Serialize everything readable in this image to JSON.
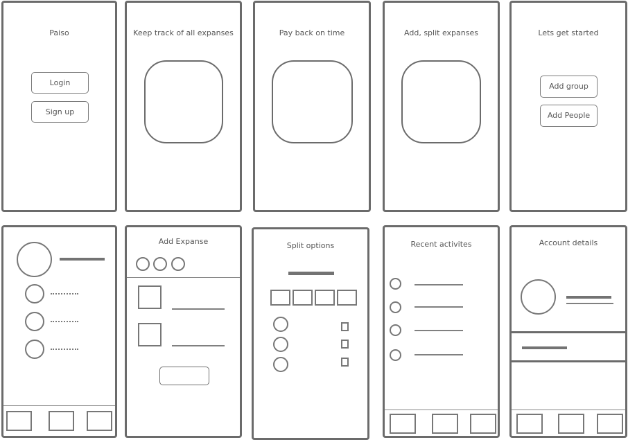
{
  "screens": {
    "splash": {
      "title": "Paiso",
      "login_label": "Login",
      "signup_label": "Sign up"
    },
    "onboard1": {
      "title": "Keep track of all expanses"
    },
    "onboard2": {
      "title": "Pay back on time"
    },
    "onboard3": {
      "title": "Add, split expanses"
    },
    "start": {
      "title": "Lets get started",
      "add_group_label": "Add group",
      "add_people_label": "Add People"
    },
    "add_expanse": {
      "title": "Add Expanse"
    },
    "split": {
      "title": "Split options"
    },
    "recent": {
      "title": "Recent activites"
    },
    "account": {
      "title": "Account details"
    }
  },
  "colors": {
    "stroke": "#6b6b6b",
    "text": "#555555"
  }
}
